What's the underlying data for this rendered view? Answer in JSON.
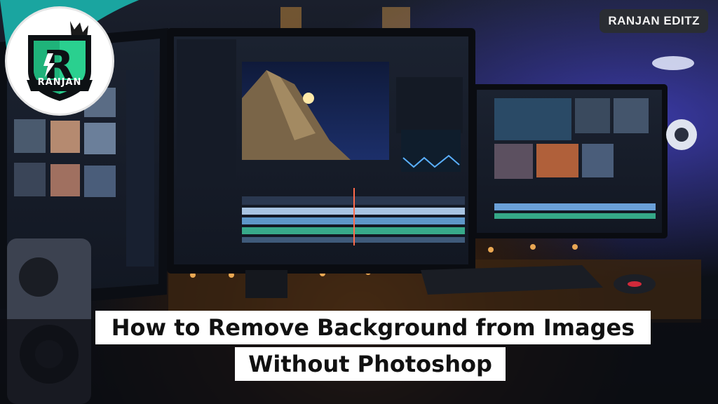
{
  "badge": {
    "text": "RANJAN EDITZ"
  },
  "logo": {
    "brand_text": "RANJAN",
    "letter": "R"
  },
  "title": {
    "line1": "How to Remove Background from Images",
    "line2": "Without Photoshop"
  }
}
